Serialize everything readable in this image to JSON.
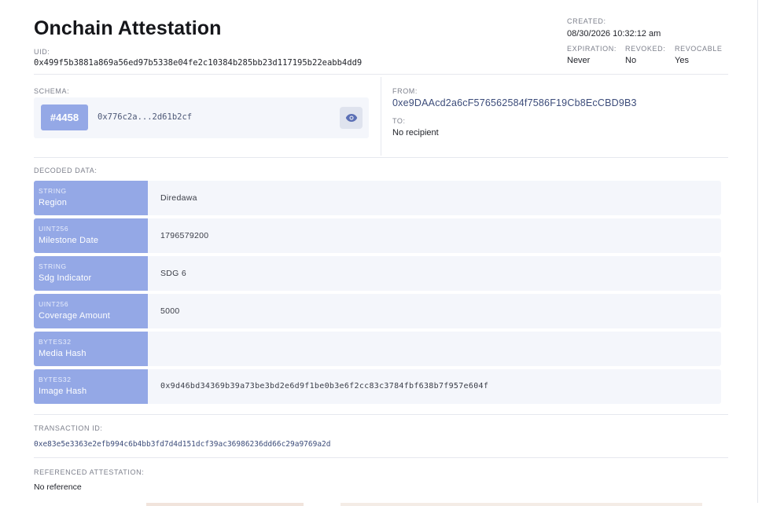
{
  "header": {
    "title": "Onchain Attestation",
    "uid_label": "UID:",
    "uid": "0x499f5b3881a869a56ed97b5338e04fe2c10384b285bb23d117195b22eabb4dd9"
  },
  "meta": {
    "created_label": "CREATED:",
    "created": "08/30/2026 10:32:12 am",
    "expiration_label": "EXPIRATION:",
    "expiration": "Never",
    "revoked_label": "REVOKED:",
    "revoked": "No",
    "revocable_label": "REVOCABLE",
    "revocable": "Yes"
  },
  "schema": {
    "label": "SCHEMA:",
    "badge": "#4458",
    "hash": "0x776c2a...2d61b2cf",
    "view_icon": "eye-icon"
  },
  "parties": {
    "from_label": "FROM:",
    "from": "0xe9DAAcd2a6cF576562584f7586F19Cb8EcCBD9B3",
    "to_label": "TO:",
    "to": "No recipient"
  },
  "decoded": {
    "label": "DECODED DATA:",
    "rows": [
      {
        "type": "STRING",
        "name": "Region",
        "value": "Diredawa"
      },
      {
        "type": "UINT256",
        "name": "Milestone Date",
        "value": "1796579200"
      },
      {
        "type": "STRING",
        "name": "Sdg Indicator",
        "value": "SDG 6"
      },
      {
        "type": "UINT256",
        "name": "Coverage Amount",
        "value": "5000"
      },
      {
        "type": "BYTES32",
        "name": "Media Hash",
        "value": ""
      },
      {
        "type": "BYTES32",
        "name": "Image Hash",
        "value": "0x9d46bd34369b39a73be3bd2e6d9f1be0b3e6f2cc83c3784fbf638b7f957e604f"
      }
    ]
  },
  "transaction": {
    "label": "TRANSACTION ID:",
    "id": "0xe83e5e3363e2efb994c6b4bb3fd7d4d151dcf39ac36986236dd66c29a9769a2d"
  },
  "referenced": {
    "label": "REFERENCED ATTESTATION:",
    "value": "No reference"
  },
  "colors": {
    "accent": "#94a8e6",
    "row_bg": "#f4f6fb",
    "link": "#3c4c7a"
  }
}
